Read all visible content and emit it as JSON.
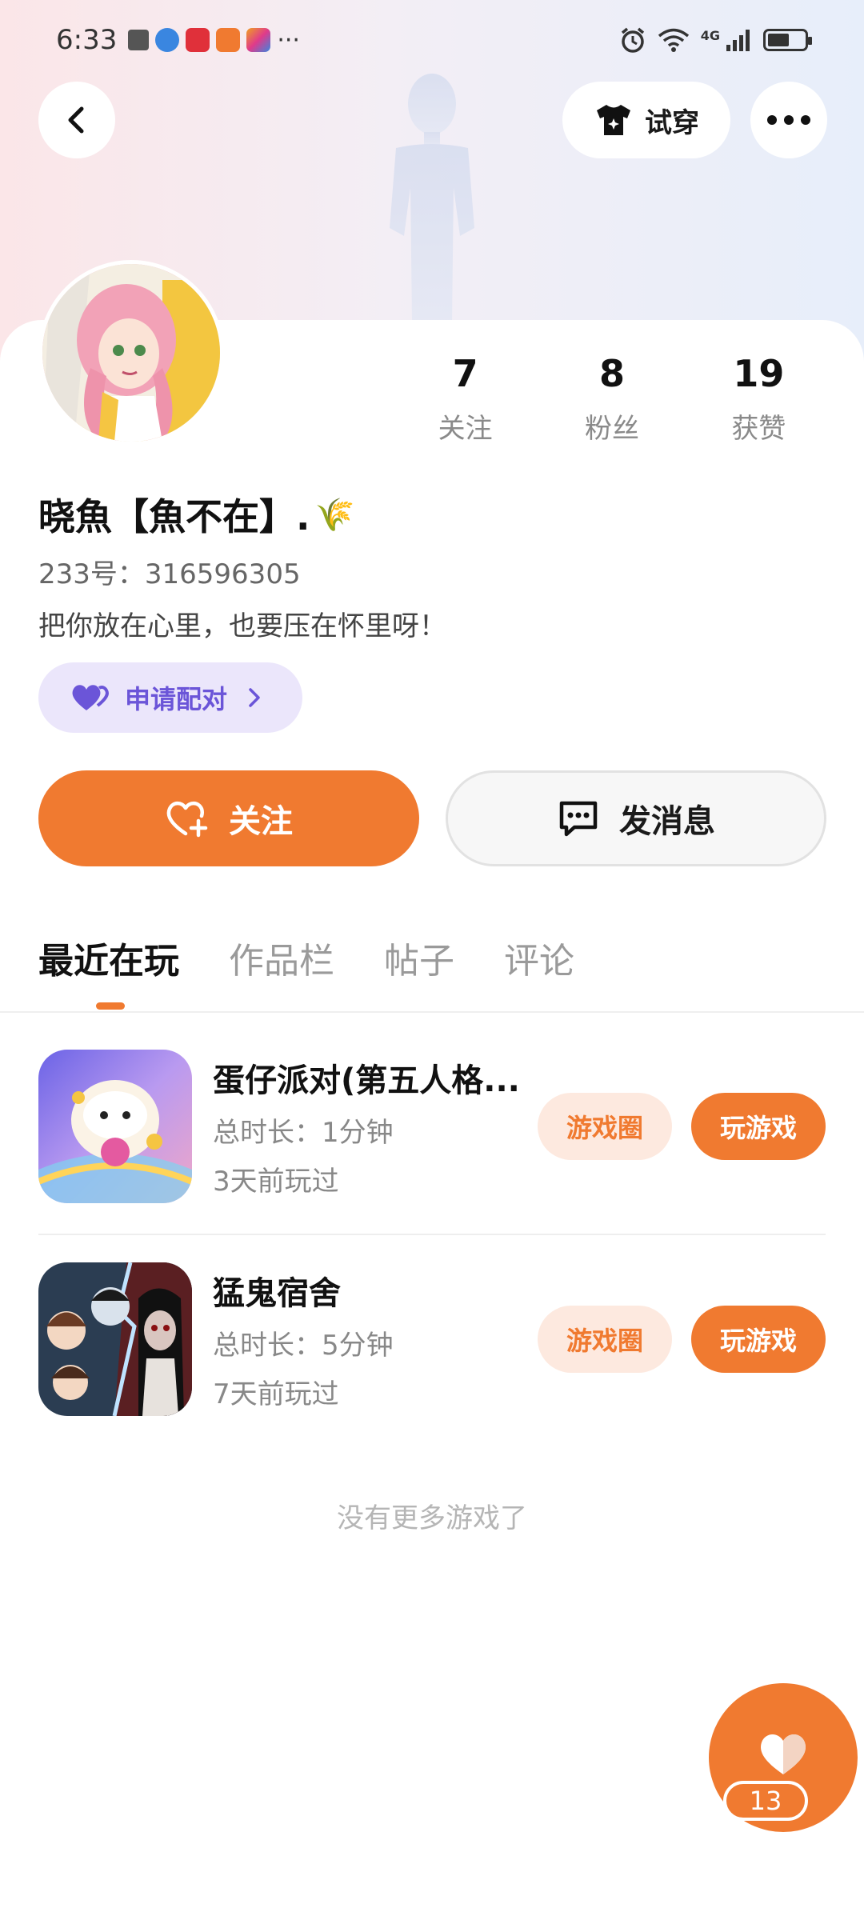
{
  "status_bar": {
    "time": "6:33",
    "more": "···",
    "network": "4G"
  },
  "header": {
    "tryon_label": "试穿"
  },
  "profile": {
    "stats": [
      {
        "value": "7",
        "label": "关注"
      },
      {
        "value": "8",
        "label": "粉丝"
      },
      {
        "value": "19",
        "label": "获赞"
      }
    ],
    "nickname": "晓魚【魚不在】.",
    "nickname_emoji": "🌾",
    "uid": "233号：316596305",
    "bio": "把你放在心里，也要压在怀里呀！",
    "pair_label": "申请配对"
  },
  "actions": {
    "follow_label": "关注",
    "message_label": "发消息"
  },
  "tabs": [
    {
      "label": "最近在玩",
      "active": true
    },
    {
      "label": "作品栏",
      "active": false
    },
    {
      "label": "帖子",
      "active": false
    },
    {
      "label": "评论",
      "active": false
    }
  ],
  "games": [
    {
      "title": "蛋仔派对(第五人格...",
      "duration": "总时长：1分钟",
      "last_played": "3天前玩过",
      "circle_label": "游戏圈",
      "play_label": "玩游戏"
    },
    {
      "title": "猛鬼宿舍",
      "duration": "总时长：5分钟",
      "last_played": "7天前玩过",
      "circle_label": "游戏圈",
      "play_label": "玩游戏"
    }
  ],
  "footer_note": "没有更多游戏了",
  "like_fab": {
    "count": "13"
  },
  "colors": {
    "accent": "#f07a30",
    "accent_soft": "#fde9df",
    "pair_bg": "#ebe6fb",
    "pair_text": "#6b55d8"
  }
}
